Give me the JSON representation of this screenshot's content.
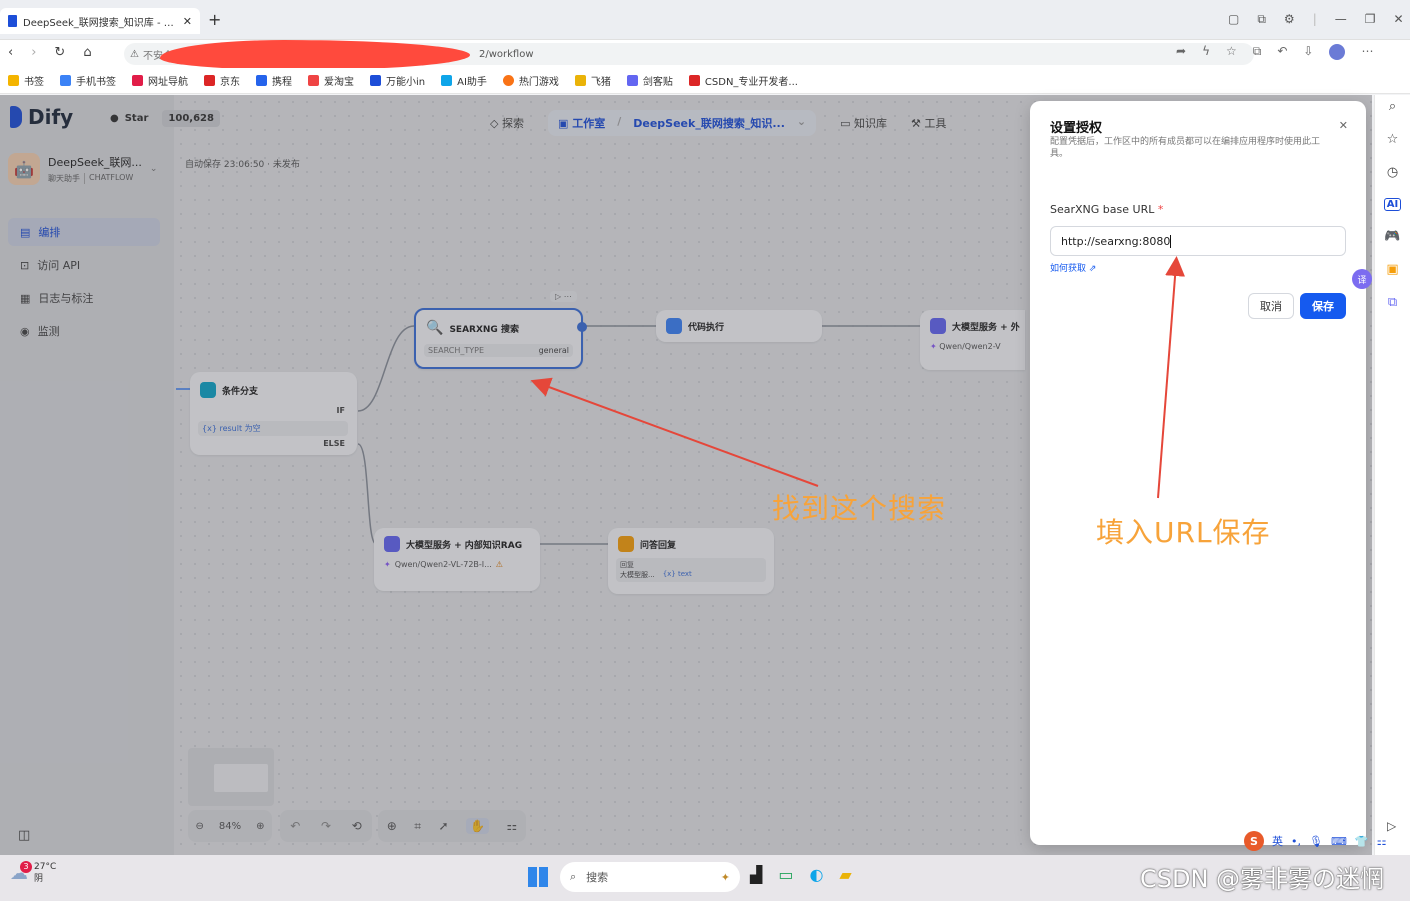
{
  "browser": {
    "tab_title": "DeepSeek_联网搜索_知识库 - Dify",
    "url_prefix": "不安全",
    "url_suffix": "2/workflow",
    "bookmarks": [
      "书签",
      "手机书签",
      "网址导航",
      "京东",
      "携程",
      "爱淘宝",
      "万能小in",
      "AI助手",
      "热门游戏",
      "飞猪",
      "剑客贴",
      "CSDN_专业开发者..."
    ]
  },
  "app": {
    "logo": "Dify",
    "star_label": "Star",
    "star_count": "100,628",
    "nav": {
      "explore": "探索",
      "studio": "工作室",
      "app_crumb": "DeepSeek_联网搜索_知识...",
      "knowledge": "知识库",
      "tools": "工具"
    },
    "app_name": "DeepSeek_联网...",
    "app_tag1": "聊天助手",
    "app_tag2": "CHATFLOW",
    "autosave": "自动保存 23:06:50 · 未发布",
    "sidebar": [
      {
        "label": "编排",
        "active": true
      },
      {
        "label": "访问 API"
      },
      {
        "label": "日志与标注"
      },
      {
        "label": "监测"
      }
    ],
    "zoom": "84%"
  },
  "nodes": {
    "searxng": {
      "title": "SEARXNG 搜索",
      "param": "SEARCH_TYPE",
      "value": "general"
    },
    "code": {
      "title": "代码执行"
    },
    "llm_ext": {
      "title": "大模型服务 + 外",
      "model": "Qwen/Qwen2-V"
    },
    "ifelse": {
      "title": "条件分支",
      "if": "IF",
      "cond": "{x} result 为空",
      "else": "ELSE"
    },
    "llm_rag": {
      "title": "大模型服务 + 内部知识RAG",
      "model": "Qwen/Qwen2-VL-72B-I..."
    },
    "answer": {
      "title": "问答回复",
      "label": "回复",
      "ref1": "大模型服...",
      "ref2": "{x} text"
    }
  },
  "dialog": {
    "title": "设置授权",
    "desc": "配置凭据后，工作区中的所有成员都可以在编排应用程序时使用此工具。",
    "field_label": "SearXNG base URL",
    "required_mark": "*",
    "field_value": "http://searxng:8080",
    "help_link": "如何获取",
    "cancel": "取消",
    "save": "保存"
  },
  "annotations": {
    "left": "找到这个搜索",
    "right": "填入URL保存"
  },
  "taskbar": {
    "weather_temp": "27°C",
    "weather_desc": "阴",
    "weather_badge": "3",
    "search": "搜索"
  },
  "ime": {
    "lang": "英"
  },
  "watermark": "CSDN @雾非雾の迷惘",
  "colors": {
    "accent": "#155aef",
    "annot": "#f7a33a",
    "arrow": "#e5473a",
    "redact": "#ff4a3d"
  }
}
